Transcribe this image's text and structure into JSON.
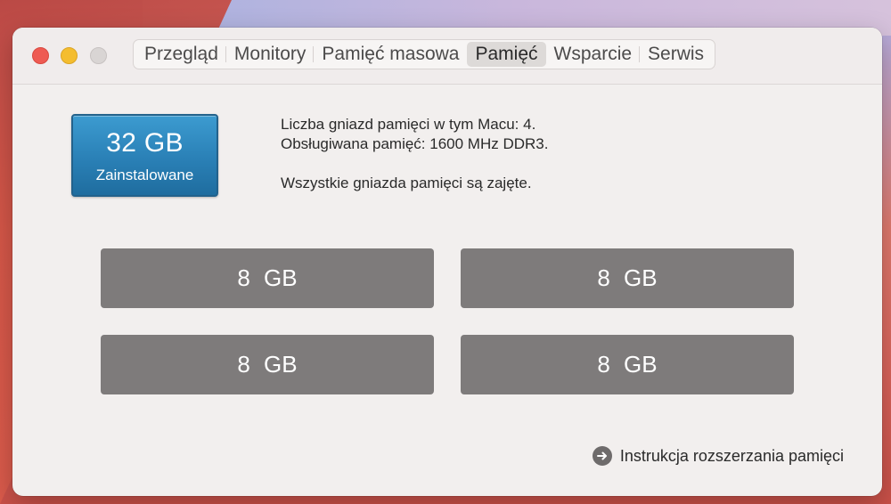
{
  "tabs": [
    {
      "label": "Przegląd"
    },
    {
      "label": "Monitory"
    },
    {
      "label": "Pamięć masowa"
    },
    {
      "label": "Pamięć",
      "active": true
    },
    {
      "label": "Wsparcie"
    },
    {
      "label": "Serwis"
    }
  ],
  "badge": {
    "size": "32 GB",
    "label": "Zainstalowane"
  },
  "info": {
    "line1": "Liczba gniazd pamięci w tym Macu: 4.",
    "line2": "Obsługiwana pamięć: 1600 MHz DDR3.",
    "line3": "Wszystkie gniazda pamięci są zajęte."
  },
  "slots": [
    {
      "size": "8 GB"
    },
    {
      "size": "8 GB"
    },
    {
      "size": "8 GB"
    },
    {
      "size": "8 GB"
    }
  ],
  "help_link": {
    "label": "Instrukcja rozszerzania pamięci",
    "icon": "arrow-circle-right-icon"
  },
  "colors": {
    "badge": "#2a80b6",
    "slot": "#7e7b7b",
    "close": "#ee5a52",
    "minimize": "#f4bd2f"
  }
}
